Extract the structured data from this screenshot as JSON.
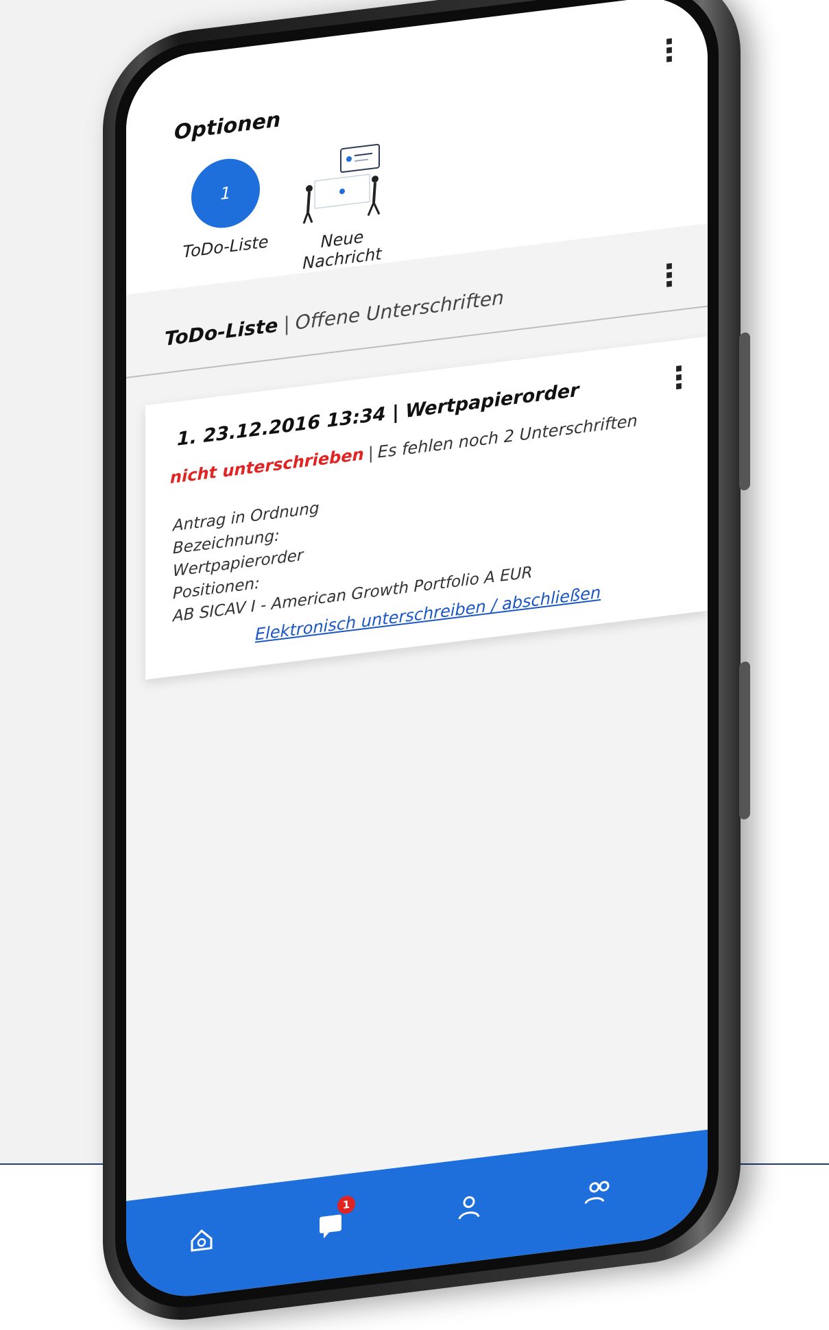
{
  "options": {
    "title": "Optionen",
    "todo": {
      "count": "1",
      "label": "ToDo-Liste"
    },
    "new_message": {
      "label": "Neue Nachricht"
    }
  },
  "section": {
    "title": "ToDo-Liste",
    "separator": "|",
    "subtitle": "Offene Unterschriften"
  },
  "todo_item": {
    "title": "1. 23.12.2016 13:34 | Wertpapierorder",
    "status": "nicht unterschrieben",
    "status_separator": "|",
    "status_info": "Es fehlen noch 2 Unterschriften",
    "details": [
      "Antrag in Ordnung",
      "Bezeichnung:",
      "Wertpapierorder",
      "Positionen:",
      "AB SICAV I - American Growth Portfolio A EUR"
    ],
    "action_link": "Elektronisch unterschreiben / abschließen"
  },
  "bottom_nav": {
    "messages_badge": "1",
    "items": [
      "home-icon",
      "messages-icon",
      "person-icon",
      "people-icon"
    ]
  },
  "colors": {
    "accent": "#1e6fdc",
    "status_red": "#e02424",
    "link": "#1a56c4",
    "background": "#f2f2f2"
  }
}
